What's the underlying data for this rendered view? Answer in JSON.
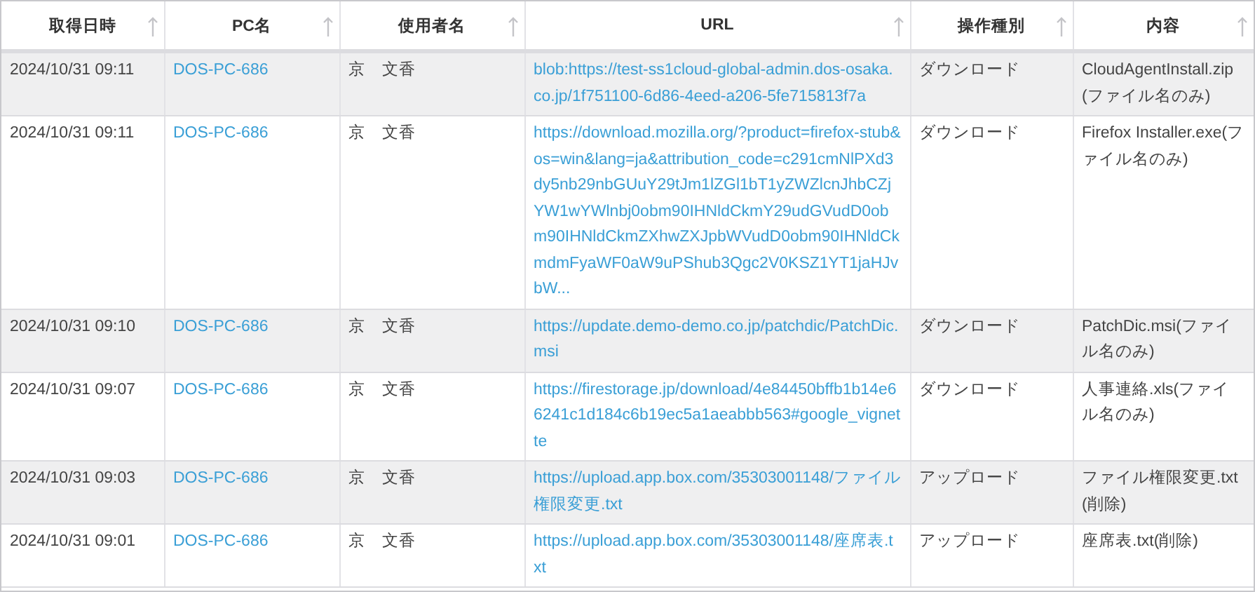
{
  "table": {
    "columns": [
      "取得日時",
      "PC名",
      "使用者名",
      "URL",
      "操作種別",
      "内容"
    ],
    "rows": [
      {
        "time": "2024/10/31 09:11",
        "pc": "DOS-PC-686",
        "user": "京　文香",
        "url": "blob:https://test-ss1cloud-global-admin.dos-osaka.co.jp/1f751100-6d86-4eed-a206-5fe715813f7a",
        "operation": "ダウンロード",
        "content": "CloudAgentInstall.zip(ファイル名のみ)"
      },
      {
        "time": "2024/10/31 09:11",
        "pc": "DOS-PC-686",
        "user": "京　文香",
        "url": "https://download.mozilla.org/?product=firefox-stub&os=win&lang=ja&attribution_code=c291cmNlPXd3dy5nb29nbGUuY29tJm1lZGl1bT1yZWZlcnJhbCZjYW1wYWlnbj0obm90IHNldCkmY29udGVudD0obm90IHNldCkmZXhwZXJpbWVudD0obm90IHNldCkmdmFyaWF0aW9uPShub3Qgc2V0KSZ1YT1jaHJvbW...",
        "operation": "ダウンロード",
        "content": "Firefox Installer.exe(ファイル名のみ)"
      },
      {
        "time": "2024/10/31 09:10",
        "pc": "DOS-PC-686",
        "user": "京　文香",
        "url": "https://update.demo-demo.co.jp/patchdic/PatchDic.msi",
        "operation": "ダウンロード",
        "content": "PatchDic.msi(ファイル名のみ)"
      },
      {
        "time": "2024/10/31 09:07",
        "pc": "DOS-PC-686",
        "user": "京　文香",
        "url": "https://firestorage.jp/download/4e84450bffb1b14e66241c1d184c6b19ec5a1aeabbb563#google_vignette",
        "operation": "ダウンロード",
        "content": "人事連絡.xls(ファイル名のみ)"
      },
      {
        "time": "2024/10/31 09:03",
        "pc": "DOS-PC-686",
        "user": "京　文香",
        "url": "https://upload.app.box.com/35303001148/ファイル権限変更.txt",
        "operation": "アップロード",
        "content": "ファイル権限変更.txt(削除)"
      },
      {
        "time": "2024/10/31 09:01",
        "pc": "DOS-PC-686",
        "user": "京　文香",
        "url": "https://upload.app.box.com/35303001148/座席表.txt",
        "operation": "アップロード",
        "content": "座席表.txt(削除)"
      }
    ]
  }
}
